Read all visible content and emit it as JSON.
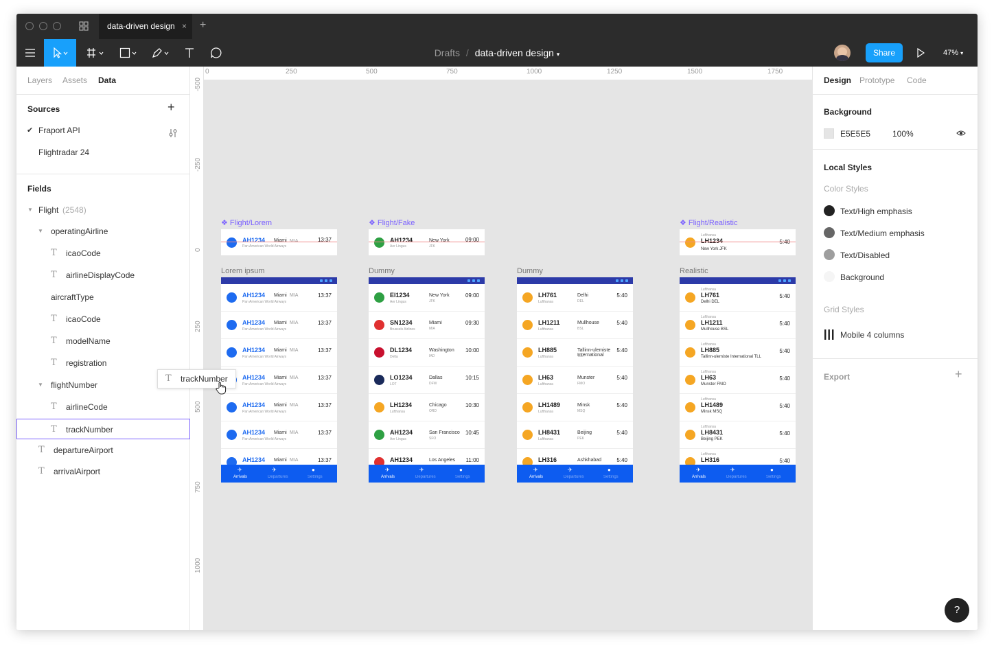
{
  "titlebar": {
    "tab_title": "data-driven design",
    "tab_close": "×",
    "new_tab": "+"
  },
  "toolbar": {
    "crumb_parent": "Drafts",
    "crumb_sep": "/",
    "crumb_file": "data-driven design",
    "share": "Share",
    "zoom": "47%"
  },
  "left": {
    "tabs": [
      "Layers",
      "Assets",
      "Data"
    ],
    "sources_title": "Sources",
    "add": "+",
    "sources": [
      "Fraport API",
      "Flightradar 24"
    ],
    "fields_title": "Fields",
    "flight": "Flight",
    "flight_count": "(2548)",
    "fields": [
      "operatingAirline",
      "icaoCode",
      "airlineDisplayCode",
      "aircraftType",
      "icaoCode",
      "modelName",
      "registration",
      "flightNumber",
      "airlineCode",
      "trackNumber",
      "departureAirport",
      "arrivalAirport"
    ],
    "drag_label": "trackNumber"
  },
  "right": {
    "tabs": [
      "Design",
      "Prototype",
      "Code"
    ],
    "background_title": "Background",
    "bg_hex": "E5E5E5",
    "bg_opacity": "100%",
    "local_styles": "Local Styles",
    "color_styles": "Color Styles",
    "styles": [
      {
        "name": "Text/High emphasis",
        "color": "#222222"
      },
      {
        "name": "Text/Medium emphasis",
        "color": "#666666"
      },
      {
        "name": "Text/Disabled",
        "color": "#9e9e9e"
      },
      {
        "name": "Background",
        "color": "#f5f5f5"
      }
    ],
    "grid_styles": "Grid Styles",
    "grid": "Mobile 4 columns",
    "export": "Export",
    "export_add": "+",
    "help": "?"
  },
  "rulers": {
    "h": [
      "0",
      "250",
      "500",
      "750",
      "1000",
      "1250",
      "1500",
      "1750"
    ],
    "v": [
      "-500",
      "-250",
      "0",
      "250",
      "500",
      "750",
      "1000"
    ]
  },
  "canvas": {
    "components": [
      {
        "label": "❖ Flight/Lorem",
        "code": "AH1234",
        "city": "Miami",
        "iata": "MIA",
        "airline": "Pan American World Airways",
        "time": "13:37"
      },
      {
        "label": "❖ Flight/Fake",
        "code": "AH1234",
        "city": "New York",
        "iata": "JFK",
        "airline": "Aer Lingus",
        "time": "09:00"
      },
      {
        "label": "❖ Flight/Realistic",
        "code": "LH1234",
        "city": "New York JFK",
        "airline": "Lufthansa",
        "time": "5:40"
      }
    ],
    "frames": [
      {
        "label": "Lorem ipsum",
        "rows": [
          {
            "code": "AH1234",
            "city": "Miami",
            "iata": "MIA",
            "sub": "Pan American World Airways",
            "time": "13:37"
          },
          {
            "code": "AH1234",
            "city": "Miami",
            "iata": "MIA",
            "sub": "Pan American World Airways",
            "time": "13:37"
          },
          {
            "code": "AH1234",
            "city": "Miami",
            "iata": "MIA",
            "sub": "Pan American World Airways",
            "time": "13:37"
          },
          {
            "code": "AH1234",
            "city": "Miami",
            "iata": "MIA",
            "sub": "Pan American World Airways",
            "time": "13:37"
          },
          {
            "code": "AH1234",
            "city": "Miami",
            "iata": "MIA",
            "sub": "Pan American World Airways",
            "time": "13:37"
          },
          {
            "code": "AH1234",
            "city": "Miami",
            "iata": "MIA",
            "sub": "Pan American World Airways",
            "time": "13:37"
          },
          {
            "code": "AH1234",
            "city": "Miami",
            "iata": "MIA",
            "sub": "",
            "time": "13:37"
          }
        ]
      },
      {
        "label": "Dummy",
        "rows": [
          {
            "code": "EI1234",
            "city": "New York",
            "iata": "JFK",
            "sub": "Aer Lingus",
            "time": "09:00"
          },
          {
            "code": "SN1234",
            "city": "Miami",
            "iata": "MIA",
            "sub": "Brussels Airlines",
            "time": "09:30"
          },
          {
            "code": "DL1234",
            "city": "Washington",
            "iata": "IAD",
            "sub": "Delta",
            "time": "10:00"
          },
          {
            "code": "LO1234",
            "city": "Dallas",
            "iata": "DFW",
            "sub": "LOT",
            "time": "10:15"
          },
          {
            "code": "LH1234",
            "city": "Chicago",
            "iata": "ORD",
            "sub": "Lufthansa",
            "time": "10:30"
          },
          {
            "code": "AH1234",
            "city": "San Francisco",
            "iata": "SFO",
            "sub": "Aer Lingus",
            "time": "10:45"
          },
          {
            "code": "AH1234",
            "city": "Los Angeles",
            "iata": "",
            "sub": "",
            "time": "11:00"
          }
        ]
      },
      {
        "label": "Dummy",
        "rows": [
          {
            "code": "LH761",
            "city": "Delhi",
            "iata": "DEL",
            "sub": "Lufthansa",
            "time": "5:40"
          },
          {
            "code": "LH1211",
            "city": "Mullhouse",
            "iata": "BSL",
            "sub": "Lufthansa",
            "time": "5:40"
          },
          {
            "code": "LH885",
            "city": "Tallinn-ulemiste International",
            "iata": "TLL",
            "sub": "Lufthansa",
            "time": "5:40"
          },
          {
            "code": "LH63",
            "city": "Munster",
            "iata": "FMO",
            "sub": "Lufthansa",
            "time": "5:40"
          },
          {
            "code": "LH1489",
            "city": "Minsk",
            "iata": "MSQ",
            "sub": "Lufthansa",
            "time": "5:40"
          },
          {
            "code": "LH8431",
            "city": "Beijing",
            "iata": "PEK",
            "sub": "Lufthansa",
            "time": "5:40"
          },
          {
            "code": "LH316",
            "city": "Ashkhabad",
            "iata": "",
            "sub": "",
            "time": "5:40"
          }
        ]
      },
      {
        "label": "Realistic",
        "rows": [
          {
            "code": "LH761",
            "city": "Delhi DEL",
            "sub": "Lufthansa",
            "time": "5:40"
          },
          {
            "code": "LH1211",
            "city": "Mullhouse BSL",
            "sub": "Lufthansa",
            "time": "5:40"
          },
          {
            "code": "LH885",
            "city": "Tallinn-ulemiste International TLL",
            "sub": "Lufthansa",
            "time": "5:40"
          },
          {
            "code": "LH63",
            "city": "Munster FMO",
            "sub": "Lufthansa",
            "time": "5:40"
          },
          {
            "code": "LH1489",
            "city": "Minsk MSQ",
            "sub": "Lufthansa",
            "time": "5:40"
          },
          {
            "code": "LH8431",
            "city": "Beijing PEK",
            "sub": "Lufthansa",
            "time": "5:40"
          },
          {
            "code": "LH316",
            "city": "",
            "sub": "Lufthansa",
            "time": "5:40"
          }
        ]
      }
    ],
    "footer": [
      "Arrivals",
      "Departures",
      "Settings"
    ]
  },
  "colors": {
    "accent": "#18a0fb",
    "selection": "#7b61ff",
    "frame_header": "#2c3aa8",
    "frame_footer": "#0d5cf0",
    "canvas": "#e5e5e5"
  }
}
